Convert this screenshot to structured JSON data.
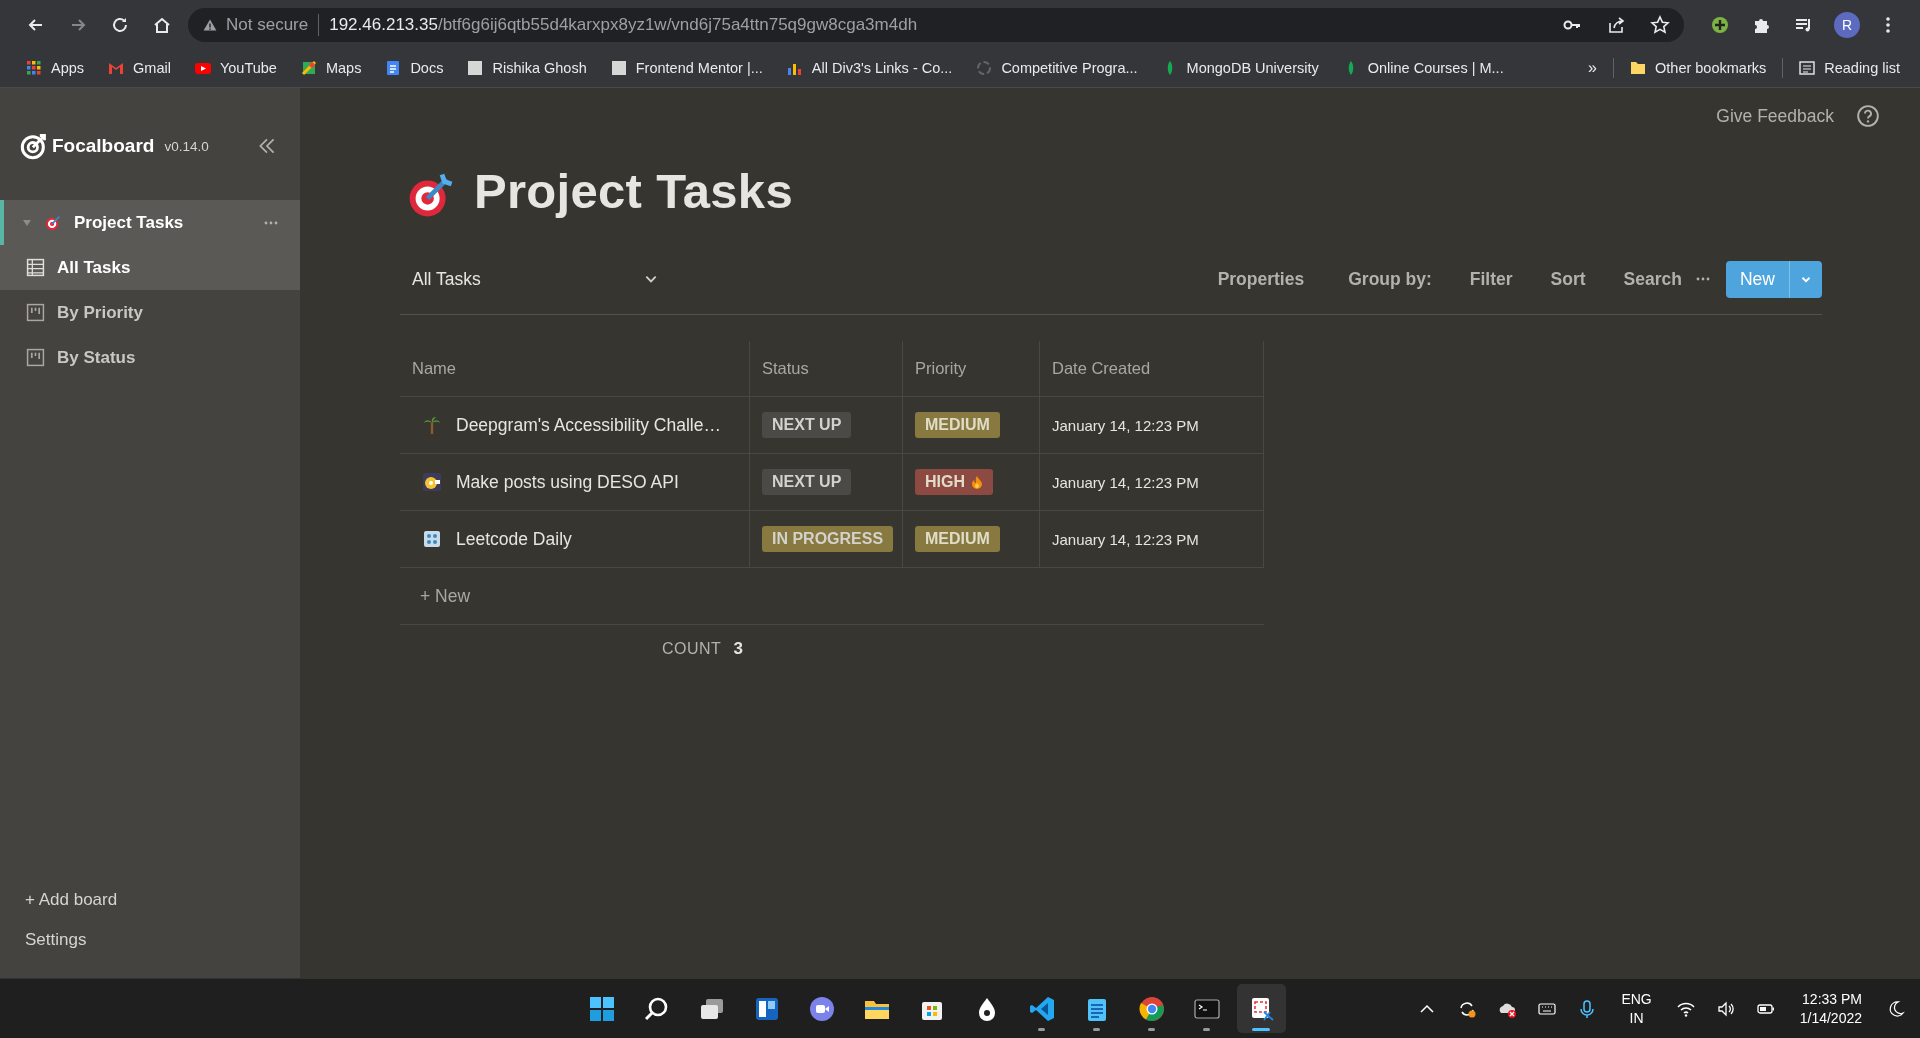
{
  "browser": {
    "security": "Not secure",
    "url_host": "192.46.213.35",
    "url_path": "/btf6g6ij6qtb55d4karxpx8yz1w/vnd6j75a4ttn75q9gw8cga3m4dh",
    "profile_initial": "R"
  },
  "bookmarks": [
    {
      "label": "Apps"
    },
    {
      "label": "Gmail"
    },
    {
      "label": "YouTube"
    },
    {
      "label": "Maps"
    },
    {
      "label": "Docs"
    },
    {
      "label": "Rishika Ghosh"
    },
    {
      "label": "Frontend Mentor |..."
    },
    {
      "label": "All Div3's Links - Co..."
    },
    {
      "label": "Competitive Progra..."
    },
    {
      "label": "MongoDB University"
    },
    {
      "label": "Online Courses | M..."
    }
  ],
  "bookmarks_more": "»",
  "other_bookmarks": "Other bookmarks",
  "reading_list": "Reading list",
  "sidebar": {
    "app_name": "Focalboard",
    "version": "v0.14.0",
    "boards": [
      {
        "title": "Project Tasks",
        "expanded": true,
        "selected": true,
        "views": [
          {
            "label": "All Tasks",
            "kind": "table",
            "selected": true
          },
          {
            "label": "By Priority",
            "kind": "board",
            "selected": false
          },
          {
            "label": "By Status",
            "kind": "board",
            "selected": false
          }
        ]
      }
    ],
    "add_board": "+ Add board",
    "settings": "Settings"
  },
  "header": {
    "feedback": "Give Feedback"
  },
  "board": {
    "title": "Project Tasks",
    "view_name": "All Tasks",
    "toolbar": [
      "Properties",
      "Group by:",
      "Filter",
      "Sort",
      "Search"
    ],
    "new_button": "New"
  },
  "table": {
    "columns": [
      "Name",
      "Status",
      "Priority",
      "Date Created"
    ],
    "rows": [
      {
        "name": "Deepgram's Accessibility Challe…",
        "status": {
          "label": "NEXT UP",
          "color": "#4b4a46"
        },
        "priority": {
          "label": "MEDIUM",
          "color": "#87793f",
          "fire": false
        },
        "date": "January 14, 12:23 PM"
      },
      {
        "name": "Make posts using DESO API",
        "status": {
          "label": "NEXT UP",
          "color": "#4b4a46"
        },
        "priority": {
          "label": "HIGH",
          "color": "#8c4a43",
          "fire": true
        },
        "date": "January 14, 12:23 PM"
      },
      {
        "name": "Leetcode Daily",
        "status": {
          "label": "IN PROGRESS",
          "color": "#87793f"
        },
        "priority": {
          "label": "MEDIUM",
          "color": "#87793f",
          "fire": false
        },
        "date": "January 14, 12:23 PM"
      }
    ],
    "add_row": "+ New",
    "count_label": "COUNT",
    "count": "3"
  },
  "taskbar": {
    "apps": [
      {
        "running": false,
        "selected": false
      },
      {
        "running": false,
        "selected": false
      },
      {
        "running": false,
        "selected": false
      },
      {
        "running": false,
        "selected": false
      },
      {
        "running": false,
        "selected": false
      },
      {
        "running": false,
        "selected": false
      },
      {
        "running": false,
        "selected": false
      },
      {
        "running": false,
        "selected": false
      },
      {
        "running": true,
        "selected": false
      },
      {
        "running": true,
        "selected": false
      },
      {
        "running": true,
        "selected": false
      },
      {
        "running": true,
        "selected": false
      },
      {
        "running": true,
        "selected": true
      }
    ],
    "lang": "ENG",
    "region": "IN",
    "time": "12:33 PM",
    "date": "1/14/2022"
  }
}
